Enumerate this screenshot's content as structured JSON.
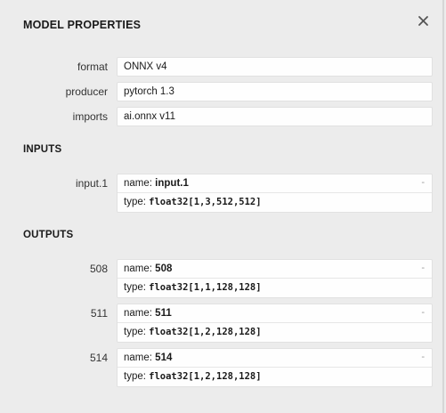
{
  "title": "MODEL PROPERTIES",
  "close_icon": "close-icon",
  "properties": [
    {
      "name": "format",
      "value": "ONNX v4"
    },
    {
      "name": "producer",
      "value": "pytorch 1.3"
    },
    {
      "name": "imports",
      "value": "ai.onnx v11"
    }
  ],
  "inputs_header": "INPUTS",
  "inputs": [
    {
      "arg": "input.1",
      "name_label": "name:",
      "name_value": "input.1",
      "type_label": "type:",
      "type_value": "float32[1,3,512,512]",
      "toggle": "-"
    }
  ],
  "outputs_header": "OUTPUTS",
  "outputs": [
    {
      "arg": "508",
      "name_label": "name:",
      "name_value": "508",
      "type_label": "type:",
      "type_value": "float32[1,1,128,128]",
      "toggle": "-"
    },
    {
      "arg": "511",
      "name_label": "name:",
      "name_value": "511",
      "type_label": "type:",
      "type_value": "float32[1,2,128,128]",
      "toggle": "-"
    },
    {
      "arg": "514",
      "name_label": "name:",
      "name_value": "514",
      "type_label": "type:",
      "type_value": "float32[1,2,128,128]",
      "toggle": "-"
    }
  ],
  "colors": {
    "background": "#ececec",
    "box": "#fefefe",
    "border": "#e1e1e1"
  }
}
